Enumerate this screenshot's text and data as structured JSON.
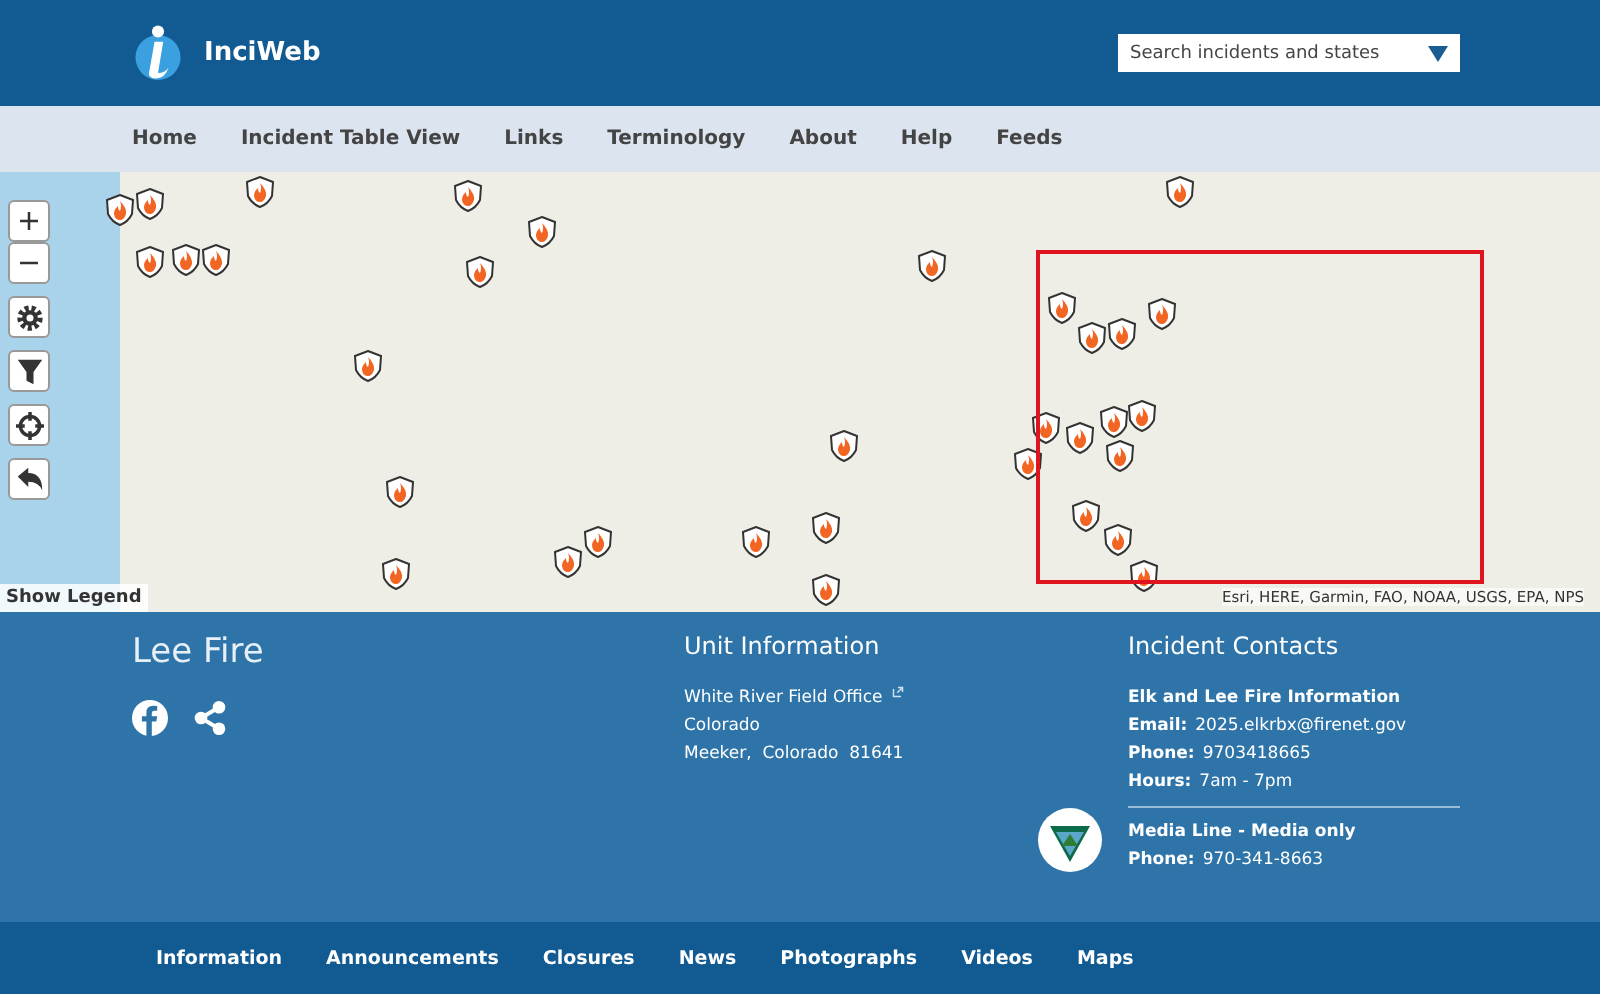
{
  "header": {
    "site_name": "InciWeb",
    "search": {
      "placeholder": "Search incidents and states"
    }
  },
  "nav": [
    "Home",
    "Incident Table View",
    "Links",
    "Terminology",
    "About",
    "Help",
    "Feeds"
  ],
  "map": {
    "legend_button": "Show Legend",
    "attribution": "Esri, HERE, Garmin, FAO, NOAA, USGS, EPA, NPS"
  },
  "incident": {
    "title": "Lee Fire"
  },
  "unit_info": {
    "heading": "Unit Information",
    "office": "White River Field Office",
    "state": "Colorado",
    "address": "Meeker,  Colorado  81641"
  },
  "contacts": {
    "heading": "Incident Contacts",
    "name": "Elk and Lee Fire Information",
    "fields": [
      {
        "label": "Email:",
        "value": "2025.elkrbx@firenet.gov"
      },
      {
        "label": "Phone:",
        "value": "9703418665"
      },
      {
        "label": "Hours:",
        "value": "7am - 7pm"
      }
    ],
    "media_name": "Media Line - Media only",
    "media_fields": [
      {
        "label": "Phone:",
        "value": "970-341-8663"
      }
    ]
  },
  "bottom_nav": [
    "Information",
    "Announcements",
    "Closures",
    "News",
    "Photographs",
    "Videos",
    "Maps"
  ]
}
